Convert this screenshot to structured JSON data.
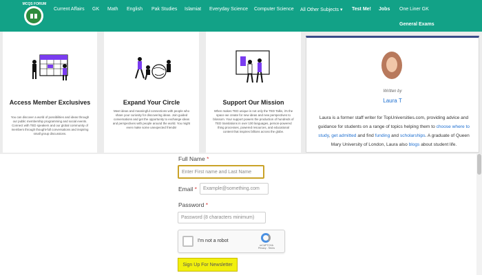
{
  "header": {
    "logo_text": "MCQS FORUM",
    "nav": [
      {
        "label": "Current Affairs"
      },
      {
        "label": "GK"
      },
      {
        "label": "Math"
      },
      {
        "label": "English"
      },
      {
        "label": "Pak Studies"
      },
      {
        "label": "Islamiat"
      },
      {
        "label": "Everyday Science"
      },
      {
        "label": "Computer Science"
      },
      {
        "label": "All Other Subjects ▾"
      },
      {
        "label": "Test Me!"
      },
      {
        "label": "Jobs"
      },
      {
        "label": "One Liner GK"
      }
    ],
    "nav_row2": "General Exams",
    "color": "#12a287"
  },
  "cards": [
    {
      "title": "Access Member Exclusives",
      "text": "You can discover a world of possibilities and ideas through our public membership programming and social events. Connect with TED speakers and our global community of members through thought-full conversations and inspiring small group discussions."
    },
    {
      "title": "Expand Your Circle",
      "text": "Meet ideas and meaningful connections with people who share your curiosity for discovering ideas. Join guided conversations and get the opportunity to exchange ideas and perspectives with people around the world. You might even make some unexpected friends!"
    },
    {
      "title": "Support Our Mission",
      "text": "When makes TED unique is not only the TED Talks, it's the space we create for new ideas and new perspectives to blossom. Your support powers the production of hundreds of TED translations in over 100 languages, person-powered thing processes, powered resources, and educational content that inspires billions across the globe."
    }
  ],
  "author": {
    "written_by": "Written by",
    "name": "Laura T",
    "bio_1": "Laura is a former staff writer for TopUniversities.com, providing advice and guidance for students on a range of topics helping them to ",
    "link_1": "choose where to study",
    "bio_2": ", ",
    "link_2": "get admitted",
    "bio_3": " and find ",
    "link_3": "funding",
    "bio_4": " and ",
    "link_4": "scholarships",
    "bio_5": ". A graduate of Queen Mary University of London, Laura also ",
    "link_5": "blogs",
    "bio_6": " about student life."
  },
  "form": {
    "full_name_label": "Full Name",
    "full_name_placeholder": "Enter First name and Last Name",
    "email_label": "Email",
    "email_placeholder": "Example@something.com",
    "password_label": "Password",
    "password_placeholder": "Password (8 characters minimum)",
    "required_mark": "*",
    "captcha_label": "I'm not a robot",
    "captcha_brand": "reCAPTCHA",
    "captcha_links": "Privacy - Terms",
    "submit_label": "Sign Up For Newsletter"
  }
}
